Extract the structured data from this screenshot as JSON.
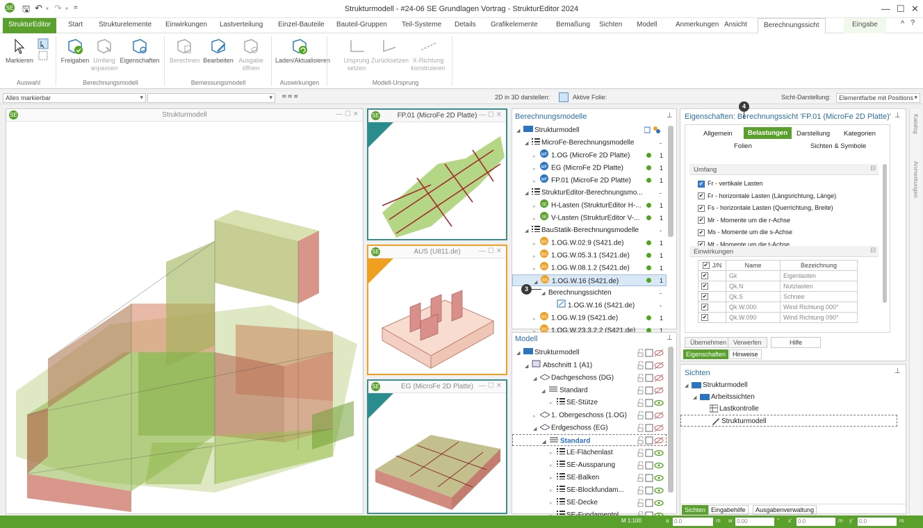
{
  "window": {
    "title": "Strukturmodell - #24-06 SE Grundlagen Vortrag - StrukturEditor 2024"
  },
  "ribbon_tabs": [
    {
      "label": "StrukturEditor"
    },
    {
      "label": "Start"
    },
    {
      "label": "Strukturelemente"
    },
    {
      "label": "Einwirkungen"
    },
    {
      "label": "Lastverteilung"
    },
    {
      "label": "Einzel-Bauteile"
    },
    {
      "label": "Bauteil-Gruppen"
    },
    {
      "label": "Teil-Systeme"
    },
    {
      "label": "Details"
    },
    {
      "label": "Grafikelemente"
    },
    {
      "label": "Bemaßung"
    },
    {
      "label": "Sichten"
    },
    {
      "label": "Modell"
    },
    {
      "label": "Anmerkungen"
    },
    {
      "label": "Ansicht"
    },
    {
      "label": "Berechnungssicht"
    },
    {
      "label": "Eingabe"
    }
  ],
  "ribbon": {
    "markieren": "Markieren",
    "freigeben": "Freigaben",
    "umfang_anpassen": "Umfang anpassen",
    "eigenschaften": "Eigenschaften",
    "berechnen": "Berechnen",
    "bearbeiten": "Bearbeiten",
    "ausgabe_oeffnen": "Ausgabe öffnen",
    "laden": "Laden/Aktualisieren",
    "ursprung_setzen": "Ursprung setzen",
    "zuruecksetzen": "Zurücksetzen",
    "x_richtung": "X-Richtung konstruieren",
    "groups": {
      "auswahl": "Auswahl",
      "berechnungsmodell": "Berechnungsmodell",
      "bemessungsmodell": "Bemessungsmodell",
      "auswirkungen": "Auswirkungen",
      "modell_ursprung": "Modell-Ursprung"
    }
  },
  "optbar": {
    "filter_value": "Alles markierbar",
    "view_2d3d_label": "2D in 3D darstellen:",
    "aktive_folie_label": "Aktive Folie:",
    "sicht_darstellung_label": "Sicht-Darstellung:",
    "sicht_darstellung_value": "Elementfarbe mit Positions"
  },
  "viewports": {
    "main": "Strukturmodell",
    "fp01": "FP.01 (MicroFe 2D Platte)",
    "aus": "AUS (U811.de)",
    "eg": "EG (MicroFe 2D Platte)"
  },
  "berechnungsmodelle": {
    "title": "Berechnungsmodelle",
    "rows": [
      {
        "label": "Strukturmodell",
        "value": ""
      },
      {
        "label": "MicroFe-Berechnungsmodelle",
        "value": "-"
      },
      {
        "label": "1.OG (MicroFe 2D Platte)",
        "value": "1"
      },
      {
        "label": "EG (MicroFe 2D Platte)",
        "value": "1"
      },
      {
        "label": "FP.01 (MicroFe 2D Platte)",
        "value": "1"
      },
      {
        "label": "StrukturEditor-Berechnungsmo...",
        "value": "-"
      },
      {
        "label": "H-Lasten (StrukturEditor H-...",
        "value": "1"
      },
      {
        "label": "V-Lasten (StrukturEditor V-...",
        "value": "1"
      },
      {
        "label": "BauStatik-Berechnungsmodelle",
        "value": "-"
      },
      {
        "label": "1.OG.W.02.9 (S421.de)",
        "value": "1"
      },
      {
        "label": "1.OG.W.05.3.1 (S421.de)",
        "value": "1"
      },
      {
        "label": "1.OG.W.08.1.2 (S421.de)",
        "value": "1"
      },
      {
        "label": "1.OG.W.16 (S421.de)",
        "value": "1"
      },
      {
        "label": "Berechnungssichten",
        "value": "-"
      },
      {
        "label": "1.OG.W.16 (S421.de)",
        "value": "-"
      },
      {
        "label": "1.OG.W.19 (S421.de)",
        "value": "1"
      },
      {
        "label": "1.OG.W.23.3.2.2 (S421.de)",
        "value": "1"
      }
    ]
  },
  "modell": {
    "title": "Modell",
    "rows": [
      {
        "label": "Strukturmodell"
      },
      {
        "label": "Abschnitt 1 (A1)"
      },
      {
        "label": "Dachgeschoss (DG)"
      },
      {
        "label": "Standard"
      },
      {
        "label": "SE-Stütze"
      },
      {
        "label": "1. Obergeschoss (1.OG)"
      },
      {
        "label": "Erdgeschoss (EG)"
      },
      {
        "label": "Standard"
      },
      {
        "label": "LE-Flächenlast"
      },
      {
        "label": "SE-Aussparung"
      },
      {
        "label": "SE-Balken"
      },
      {
        "label": "SE-Blockfundam..."
      },
      {
        "label": "SE-Decke"
      },
      {
        "label": "SE-Fundamentpl..."
      }
    ]
  },
  "eigenschaften": {
    "title": "Eigenschaften: Berechnungssicht 'FP.01 (MicroFe 2D Platte)'",
    "tabs": [
      "Allgemein",
      "Belastungen",
      "Darstellung",
      "Kategorien",
      "Folien",
      "Sichten & Symbole"
    ],
    "umfang_title": "Umfang",
    "umfang_items": [
      "Fr - vertikale Lasten",
      "Fr - horizontale Lasten (Längsrichtung, Länge)",
      "Fs - horizontale Lasten (Querrichtung, Breite)",
      "Mr - Momente um die r-Achse",
      "Ms - Momente um die s-Achse",
      "Mt - Momente um die t-Achse"
    ],
    "einwirkungen_title": "Einwirkungen",
    "table_headers": [
      "J/N",
      "Name",
      "Bezeichnung"
    ],
    "table_rows": [
      [
        "Gk",
        "Eigenlasten"
      ],
      [
        "Qk.N",
        "Nutzlasten"
      ],
      [
        "Qk.S",
        "Schnee"
      ],
      [
        "Qk.W.000",
        "Wind Richtung 000°"
      ],
      [
        "Qk.W.090",
        "Wind Richtung 090°"
      ]
    ],
    "btn_uebernehmen": "Übernehmen",
    "btn_verwerfen": "Verwerfen",
    "btn_hilfe": "Hilfe",
    "subtab_eigenschaften": "Eigenschaften",
    "subtab_hinweise": "Hinweise"
  },
  "sichten": {
    "title": "Sichten",
    "rows": [
      "Strukturmodell",
      "Arbeitssichten",
      "Lastkontrolle",
      "Strukturmodell"
    ],
    "bottom_tabs": [
      "Sichten",
      "Eingabehilfe",
      "Ausgabenverwaltung"
    ]
  },
  "side_tabs": [
    "Katalog",
    "Anmerkungen"
  ],
  "badges": {
    "three": "3",
    "four": "4"
  },
  "statusbar": {
    "scale": "M 1:100",
    "a_label": "a",
    "a_value": "0.0",
    "w_label": "w",
    "w_value": "0.00",
    "x_label": "x'",
    "x_value": "0.0",
    "y_label": "y'",
    "y_value": "0.0",
    "unit_m": "m",
    "unit_deg": "°"
  },
  "colors": {
    "accent": "#5aa02c",
    "link": "#2a6fa8"
  }
}
